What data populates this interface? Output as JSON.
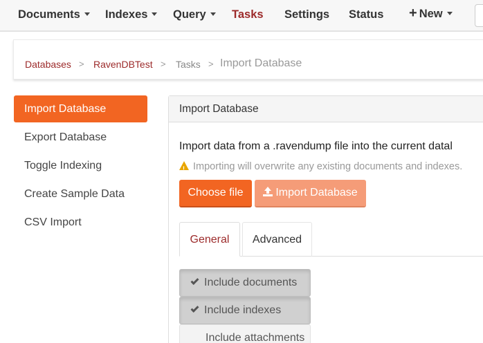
{
  "navbar": {
    "items": [
      {
        "label": "Documents",
        "dropdown": true
      },
      {
        "label": "Indexes",
        "dropdown": true
      },
      {
        "label": "Query",
        "dropdown": true
      },
      {
        "label": "Tasks",
        "active": true
      },
      {
        "label": "Settings"
      },
      {
        "label": "Status"
      }
    ],
    "new_label": "New"
  },
  "breadcrumb": {
    "items": [
      "Databases",
      "RavenDBTest",
      "Tasks"
    ],
    "current": "Import Database",
    "separator": ">"
  },
  "sidebar": {
    "items": [
      {
        "label": "Import Database",
        "active": true
      },
      {
        "label": "Export Database"
      },
      {
        "label": "Toggle Indexing"
      },
      {
        "label": "Create Sample Data"
      },
      {
        "label": "CSV Import"
      }
    ]
  },
  "panel": {
    "title": "Import Database",
    "intro": "Import data from a .ravendump file into the current datal",
    "warning": "Importing will overwrite any existing documents and indexes.",
    "choose_file_label": "Choose file",
    "import_label": "Import Database",
    "tabs": [
      {
        "label": "General",
        "active": true
      },
      {
        "label": "Advanced"
      }
    ],
    "options": [
      {
        "label": "Include documents",
        "checked": true
      },
      {
        "label": "Include indexes",
        "checked": true
      },
      {
        "label": "Include attachments",
        "checked": false
      }
    ]
  },
  "colors": {
    "accent": "#f26522",
    "accent_light": "#f59c78",
    "link": "#9c2a2a"
  }
}
